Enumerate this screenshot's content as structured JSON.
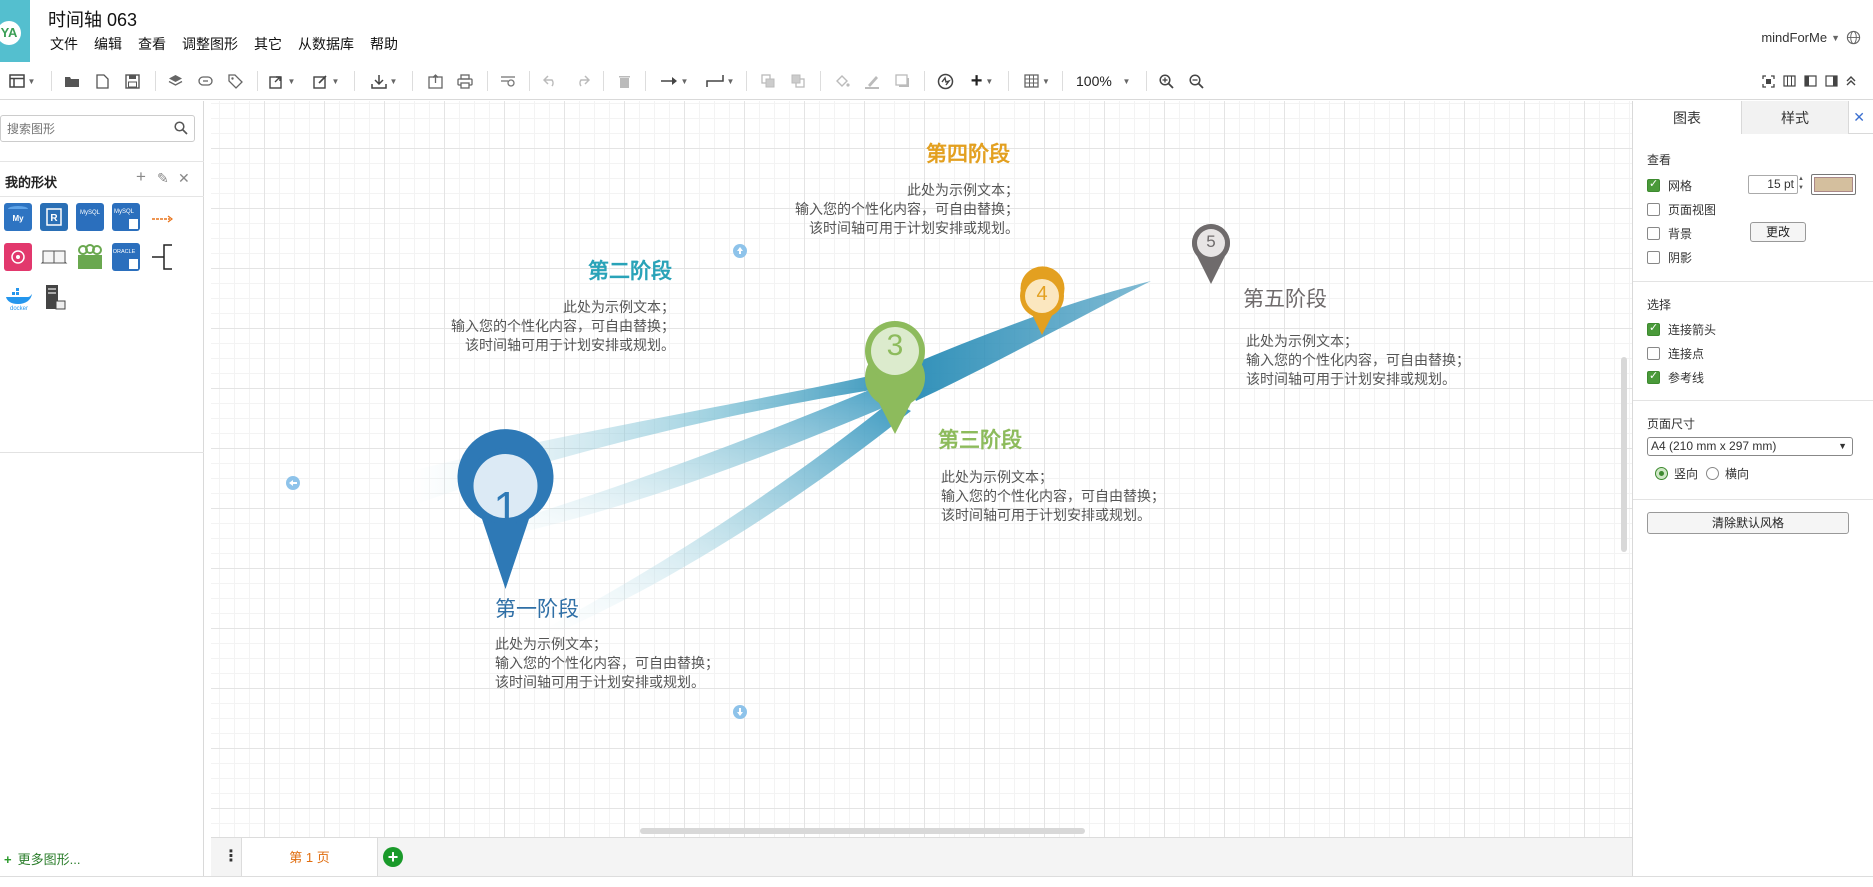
{
  "app": {
    "avatar": "YA",
    "title": "时间轴 063",
    "menu": [
      "文件",
      "编辑",
      "查看",
      "调整图形",
      "其它",
      "从数据库",
      "帮助"
    ],
    "user": "mindForMe"
  },
  "toolbar": {
    "zoom": "100%"
  },
  "sidebar": {
    "search_placeholder": "搜索图形",
    "my_shapes": "我的形状",
    "more_shapes": "更多图形..."
  },
  "diagram": {
    "phases": [
      {
        "number": "1",
        "title": "第一阶段",
        "color": "#2f6fa6",
        "lines": [
          "此处为示例文本；",
          "输入您的个性化内容，可自由替换；",
          "该时间轴可用于计划安排或规划。"
        ]
      },
      {
        "number": "2",
        "title": "第二阶段",
        "color": "#29a3b8",
        "lines": [
          "此处为示例文本；",
          "输入您的个性化内容，可自由替换；",
          "该时间轴可用于计划安排或规划。"
        ]
      },
      {
        "number": "3",
        "title": "第三阶段",
        "color": "#8dbb5c",
        "lines": [
          "此处为示例文本；",
          "输入您的个性化内容，可自由替换；",
          "该时间轴可用于计划安排或规划。"
        ]
      },
      {
        "number": "4",
        "title": "第四阶段",
        "color": "#e3a020",
        "lines": [
          "此处为示例文本；",
          "输入您的个性化内容，可自由替换；",
          "该时间轴可用于计划安排或规划。"
        ]
      },
      {
        "number": "5",
        "title": "第五阶段",
        "color": "#6f6b6c",
        "lines": [
          "此处为示例文本；",
          "输入您的个性化内容，可自由替换；",
          "该时间轴可用于计划安排或规划。"
        ]
      }
    ]
  },
  "pages": {
    "current": "第 1 页"
  },
  "format_panel": {
    "tabs": [
      "图表",
      "样式"
    ],
    "view_section": "查看",
    "grid_label": "网格",
    "grid_size": "15 pt",
    "grid_color": "#d4bf9e",
    "page_view_label": "页面视图",
    "background_label": "背景",
    "change_button": "更改",
    "shadow_label": "阴影",
    "options_section": "选择",
    "connection_arrows_label": "连接箭头",
    "connection_points_label": "连接点",
    "guides_label": "参考线",
    "page_size_section": "页面尺寸",
    "page_size_value": "A4 (210 mm x 297 mm)",
    "portrait_label": "竖向",
    "landscape_label": "横向",
    "clear_style_button": "清除默认风格"
  }
}
